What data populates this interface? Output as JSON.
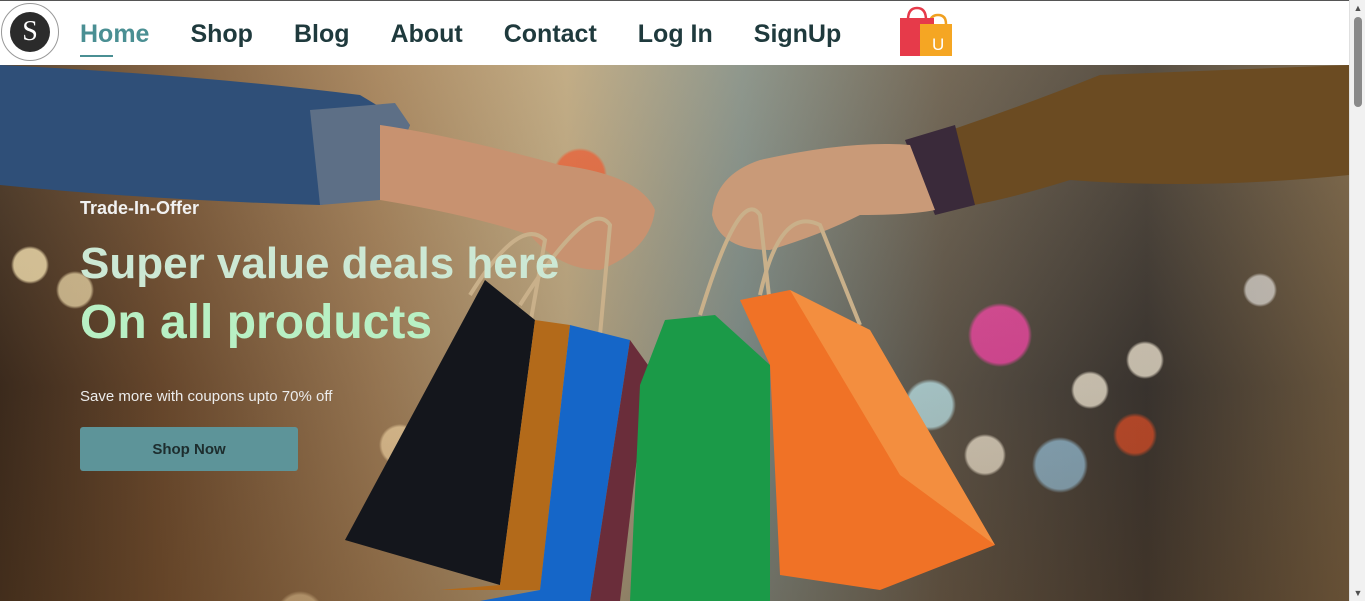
{
  "header": {
    "logo_letter": "S",
    "nav": [
      {
        "label": "Home",
        "active": true
      },
      {
        "label": "Shop",
        "active": false
      },
      {
        "label": "Blog",
        "active": false
      },
      {
        "label": "About",
        "active": false
      },
      {
        "label": "Contact",
        "active": false
      },
      {
        "label": "Log In",
        "active": false
      },
      {
        "label": "SignUp",
        "active": false
      }
    ],
    "cart_icon": "shopping-bag-icon",
    "cart_icon_letter": "U"
  },
  "hero": {
    "tag": "Trade-In-Offer",
    "headline_1": "Super value deals here",
    "headline_2": "On all products",
    "subtext": "Save more with coupons upto 70% off",
    "button_label": "Shop Now"
  },
  "colors": {
    "accent": "#4a8f93",
    "nav_text": "#1f3a3d",
    "button_bg": "#5d9499",
    "headline_1": "#cce8d4",
    "headline_2": "#b8f0c4"
  },
  "scrollbar": {
    "up_icon": "scroll-up-arrow-icon",
    "down_icon": "scroll-down-arrow-icon"
  }
}
